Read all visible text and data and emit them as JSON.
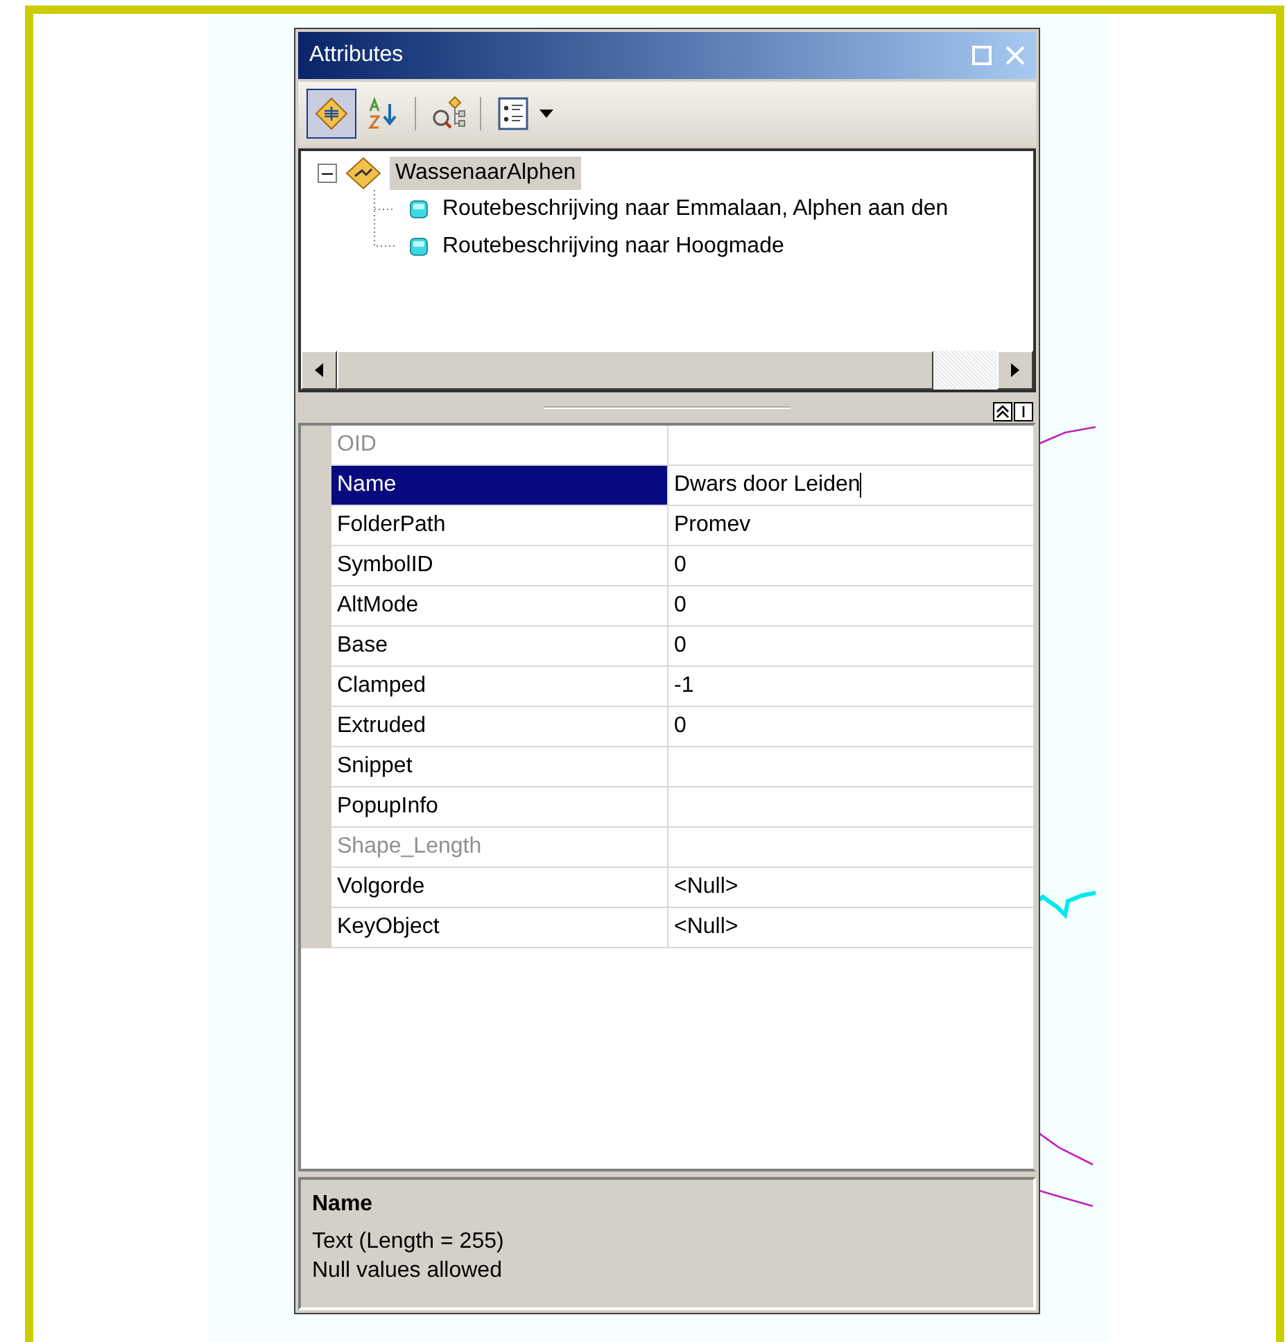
{
  "window": {
    "title": "Attributes"
  },
  "toolbar": [
    {
      "kind": "by-layer",
      "selected": true
    },
    {
      "kind": "sort",
      "selected": false
    },
    {
      "kind": "locate",
      "selected": false
    },
    {
      "kind": "options",
      "selected": false
    }
  ],
  "tree": {
    "label": "WassenaarAlphen",
    "expanded": true,
    "selected": true,
    "children": [
      {
        "label": "Routebeschrijving naar Emmalaan, Alphen aan den"
      },
      {
        "label": "Routebeschrijving naar Hoogmade"
      }
    ]
  },
  "rows": [
    {
      "field": "OID",
      "value": "",
      "disabled": true,
      "selected": false
    },
    {
      "field": "Name",
      "value": "Dwars door Leiden",
      "disabled": false,
      "selected": true
    },
    {
      "field": "FolderPath",
      "value": "Promev",
      "disabled": false,
      "selected": false
    },
    {
      "field": "SymbolID",
      "value": "0",
      "disabled": false,
      "selected": false
    },
    {
      "field": "AltMode",
      "value": "0",
      "disabled": false,
      "selected": false
    },
    {
      "field": "Base",
      "value": "0",
      "disabled": false,
      "selected": false
    },
    {
      "field": "Clamped",
      "value": "-1",
      "disabled": false,
      "selected": false
    },
    {
      "field": "Extruded",
      "value": "0",
      "disabled": false,
      "selected": false
    },
    {
      "field": "Snippet",
      "value": "",
      "disabled": false,
      "selected": false
    },
    {
      "field": "PopupInfo",
      "value": "",
      "disabled": false,
      "selected": false
    },
    {
      "field": "Shape_Length",
      "value": "",
      "disabled": true,
      "selected": false
    },
    {
      "field": "Volgorde",
      "value": "<Null>",
      "disabled": false,
      "selected": false
    },
    {
      "field": "KeyObject",
      "value": "<Null>",
      "disabled": false,
      "selected": false
    }
  ],
  "description": {
    "title": "Name",
    "lines": [
      "Text (Length = 255)",
      "Null values allowed"
    ]
  }
}
